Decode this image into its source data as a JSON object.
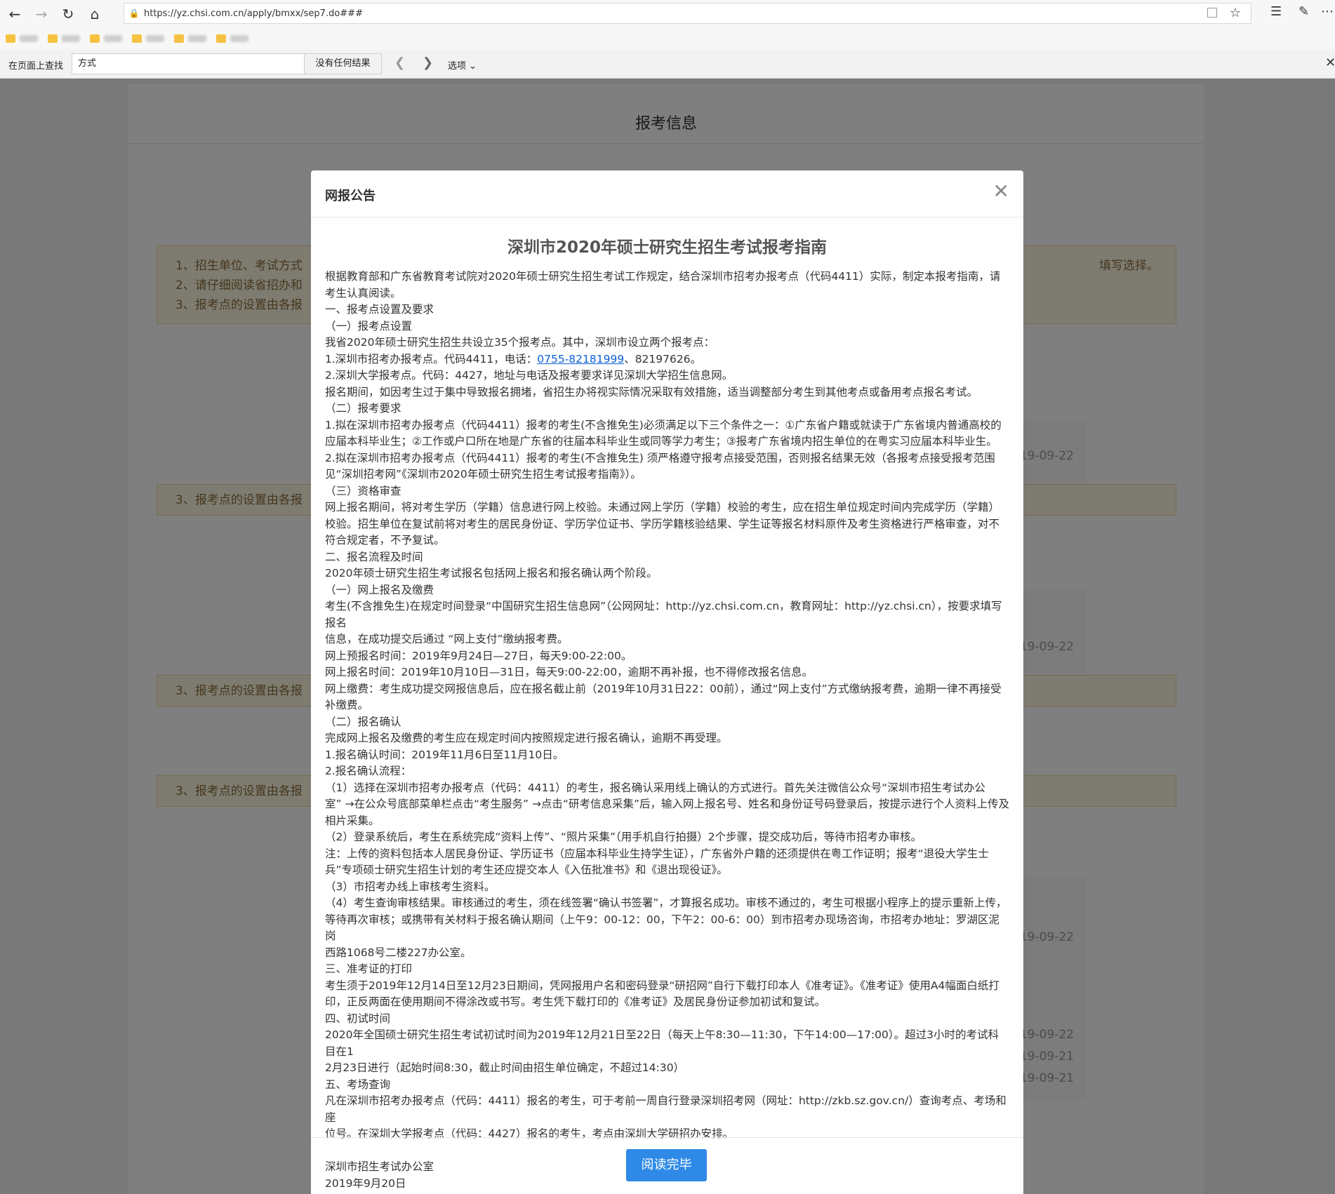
{
  "browser": {
    "url": "https://yz.chsi.com.cn/apply/bmxx/sep7.do###",
    "find_label": "在页面上查找",
    "find_value": "方式",
    "find_result": "没有任何结果",
    "find_options": "选项"
  },
  "page": {
    "title": "报考信息",
    "notice_lines": [
      "1、招生单位、考试方式",
      "2、请仔细阅读省招办和",
      "3、报考点的设置由各报"
    ],
    "notice_right": "填写选择。",
    "repeat_notice": "3、报考点的设置由各报",
    "dates": [
      "19-09-22",
      "19-09-22",
      "19-09-22",
      "19-09-22",
      "19-09-21",
      "19-09-21"
    ]
  },
  "modal": {
    "header": "网报公告",
    "doc_title": "深圳市2020年硕士研究生招生考试报考指南",
    "lines": [
      "根据教育部和广东省教育考试院对2020年硕士研究生招生考试工作规定，结合深圳市招考办报考点（代码4411）实际，制定本报考指南，请",
      "考生认真阅读。",
      "一、报考点设置及要求",
      "（一）报考点设置",
      "我省2020年硕士研究生招生共设立35个报考点。其中，深圳市设立两个报考点：",
      "1.深圳市招考办报考点。代码4411，电话：",
      "2.深圳大学报考点。代码：4427，地址与电话及报考要求详见深圳大学招生信息网。",
      "报名期间，如因考生过于集中导致报名拥堵，省招生办将视实际情况采取有效措施，适当调整部分考生到其他考点或备用考点报名考试。",
      "（二）报考要求",
      "1.拟在深圳市招考办报考点（代码4411）报考的考生(不含推免生)必须满足以下三个条件之一：①广东省户籍或就读于广东省境内普通高校的",
      "应届本科毕业生；②工作或户口所在地是广东省的往届本科毕业生或同等学力考生；③报考广东省境内招生单位的在粤实习应届本科毕业生。",
      "2.拟在深圳市招考办报考点（代码4411）报考的考生(不含推免生) 须严格遵守报考点接受范围，否则报名结果无效（各报考点接受报考范围",
      "见“深圳招考网”《深圳市2020年硕士研究生招生考试报考指南》）。",
      "（三）资格审查",
      "网上报名期间，将对考生学历（学籍）信息进行网上校验。未通过网上学历（学籍）校验的考生，应在招生单位规定时间内完成学历（学籍）",
      "校验。招生单位在复试前将对考生的居民身份证、学历学位证书、学历学籍核验结果、学生证等报名材料原件及考生资格进行严格审查，对不",
      "符合规定者，不予复试。",
      "二、报名流程及时间",
      "2020年硕士研究生招生考试报名包括网上报名和报名确认两个阶段。",
      "（一）网上报名及缴费",
      "考生(不含推免生)在规定时间登录“中国研究生招生信息网”（公网网址：http://yz.chsi.com.cn，教育网址：http://yz.chsi.cn），按要求填写报名",
      "信息，在成功提交后通过 “网上支付”缴纳报考费。",
      "网上预报名时间：2019年9月24日—27日，每天9:00-22:00。",
      "网上报名时间：2019年10月10日—31日，每天9:00-22:00，逾期不再补报，也不得修改报名信息。",
      "网上缴费：考生成功提交网报信息后，应在报名截止前（2019年10月31日22：00前），通过“网上支付”方式缴纳报考费，逾期一律不再接受",
      "补缴费。",
      "（二）报名确认",
      "完成网上报名及缴费的考生应在规定时间内按照规定进行报名确认，逾期不再受理。",
      "1.报名确认时间：2019年11月6日至11月10日。",
      "2.报名确认流程：",
      "（1）选择在深圳市招考办报考点（代码：4411）的考生，报名确认采用线上确认的方式进行。首先关注微信公众号“深圳市招生考试办公",
      "室” →在公众号底部菜单栏点击“考生服务” →点击“研考信息采集”后，输入网上报名号、姓名和身份证号码登录后，按提示进行个人资料上传及",
      "相片采集。",
      "（2）登录系统后，考生在系统完成“资料上传”、“照片采集”（用手机自行拍摄）2个步骤，提交成功后，等待市招考办审核。",
      "注：上传的资料包括本人居民身份证、学历证书（应届本科毕业生持学生证），广东省外户籍的还须提供在粤工作证明；报考“退役大学生士",
      "兵”专项硕士研究生招生计划的考生还应提交本人《入伍批准书》和《退出现役证》。",
      "（3）市招考办线上审核考生资料。",
      "（4）考生查询审核结果。审核通过的考生，须在线签署“确认书签署”，才算报名成功。审核不通过的，考生可根据小程序上的提示重新上传，",
      "等待再次审核；或携带有关材料于报名确认期间（上午9：00-12：00，下午2：00-6：00）到市招考办现场咨询，市招考办地址：罗湖区泥岗",
      "西路1068号二楼227办公室。",
      "三、准考证的打印",
      "考生须于2019年12月14日至12月23日期间，凭网报用户名和密码登录“研招网”自行下载打印本人《准考证》。《准考证》使用A4幅面白纸打",
      "印，正反两面在使用期间不得涂改或书写。考生凭下载打印的《准考证》及居民身份证参加初试和复试。",
      "四、初试时间",
      "2020年全国硕士研究生招生考试初试时间为2019年12月21日至22日（每天上午8:30—11:30，下午14:00—17:00）。超过3小时的考试科目在1",
      "2月23日进行（起始时间8:30，截止时间由招生单位确定，不超过14:30）",
      "五、考场查询",
      "凡在深圳市招考办报考点（代码：4411）报名的考生，可于考前一周自行登录深圳招考网（网址：http://zkb.sz.gov.cn/）查询考点、考场和座",
      "位号。在深圳大学报考点（代码：4427）报名的考生，考点由深圳大学研招办安排。"
    ],
    "phone_link": "0755-82181999",
    "phone_tail": "、82197626。",
    "sign_org": "深圳市招生考试办公室",
    "sign_date": "2019年9月20日",
    "button": "阅读完毕"
  }
}
